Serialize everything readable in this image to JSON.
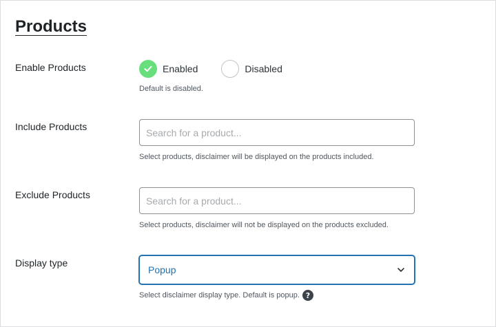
{
  "page": {
    "title": "Products"
  },
  "enable_products": {
    "label": "Enable Products",
    "options": [
      {
        "label": "Enabled",
        "checked": true
      },
      {
        "label": "Disabled",
        "checked": false
      }
    ],
    "description": "Default is disabled."
  },
  "include_products": {
    "label": "Include Products",
    "placeholder": "Search for a product...",
    "description": "Select products, disclaimer will be displayed on the products included."
  },
  "exclude_products": {
    "label": "Exclude Products",
    "placeholder": "Search for a product...",
    "description": "Select products, disclaimer will not be displayed on the products excluded."
  },
  "display_type": {
    "label": "Display type",
    "selected": "Popup",
    "description": "Select disclaimer display type. Default is popup.",
    "help_glyph": "?"
  },
  "colors": {
    "accent": "#2271b1",
    "enabled_green": "#68de7c",
    "text": "#1d2327",
    "muted": "#50575e"
  },
  "icons": {
    "checked": "check-icon",
    "select": "chevron-down-icon",
    "help": "help-icon"
  }
}
